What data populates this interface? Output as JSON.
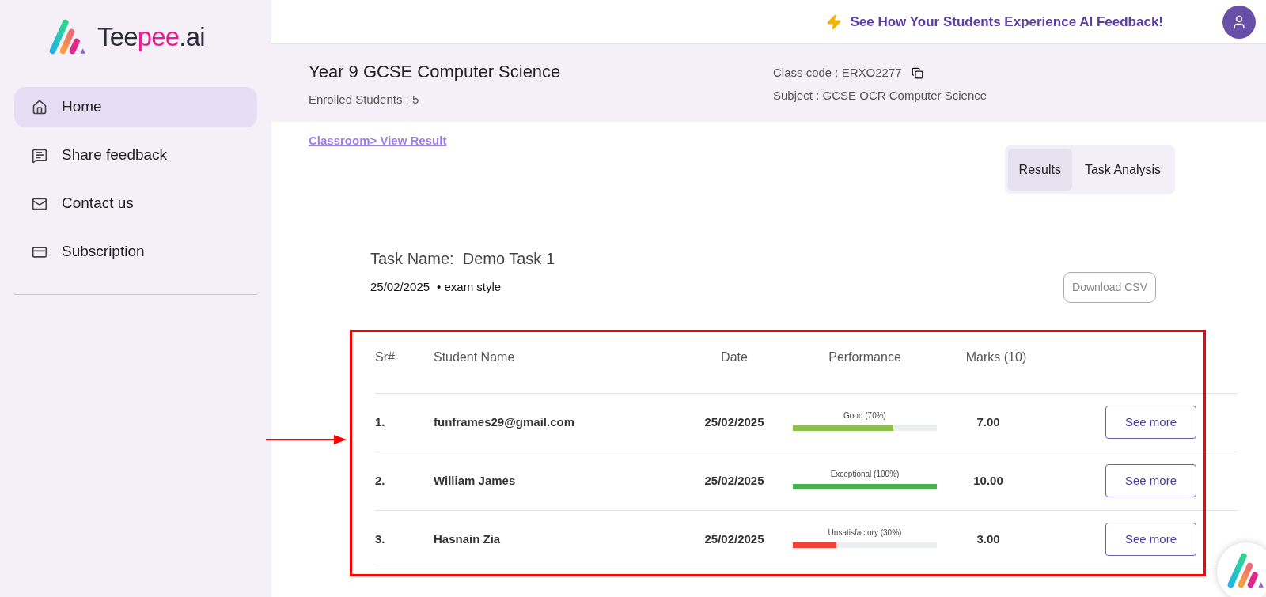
{
  "logo": {
    "parts": [
      "Tee",
      "pee",
      ".ai"
    ]
  },
  "sidebar": {
    "items": [
      {
        "label": "Home",
        "selected": true
      },
      {
        "label": "Share feedback",
        "selected": false
      },
      {
        "label": "Contact us",
        "selected": false
      },
      {
        "label": "Subscription",
        "selected": false
      }
    ]
  },
  "header": {
    "promo": "See How Your Students Experience AI Feedback!"
  },
  "class": {
    "title": "Year 9 GCSE Computer Science",
    "enrolled": "Enrolled Students : 5",
    "class_code": "Class code : ERXO2277",
    "subject": "Subject : GCSE OCR Computer Science"
  },
  "breadcrumb": "Classroom> View Result",
  "tabs": [
    {
      "label": "Results",
      "selected": true
    },
    {
      "label": "Task Analysis",
      "selected": false
    }
  ],
  "task": {
    "name": "Task Name:  Demo Task 1",
    "date": "25/02/2025",
    "type": "• exam style",
    "download": "Download CSV"
  },
  "table": {
    "columns": [
      "Sr#",
      "Student Name",
      "Date",
      "Performance",
      "Marks (10)"
    ],
    "rows": [
      {
        "sr": "1.",
        "name": "funframes29@gmail.com",
        "date": "25/02/2025",
        "performance": "Good (70%)",
        "level": 0.7,
        "color": "#8bc34a",
        "marks": "7.00",
        "action": "See more"
      },
      {
        "sr": "2.",
        "name": "William James",
        "date": "25/02/2025",
        "performance": "Exceptional (100%)",
        "level": 1,
        "color": "#4caf50",
        "marks": "10.00",
        "action": "See more"
      },
      {
        "sr": "3.",
        "name": "Hasnain Zia",
        "date": "25/02/2025",
        "performance": "Unsatisfactory (30%)",
        "level": 0.3,
        "color": "#f44336",
        "marks": "3.00",
        "action": "See more"
      }
    ]
  }
}
